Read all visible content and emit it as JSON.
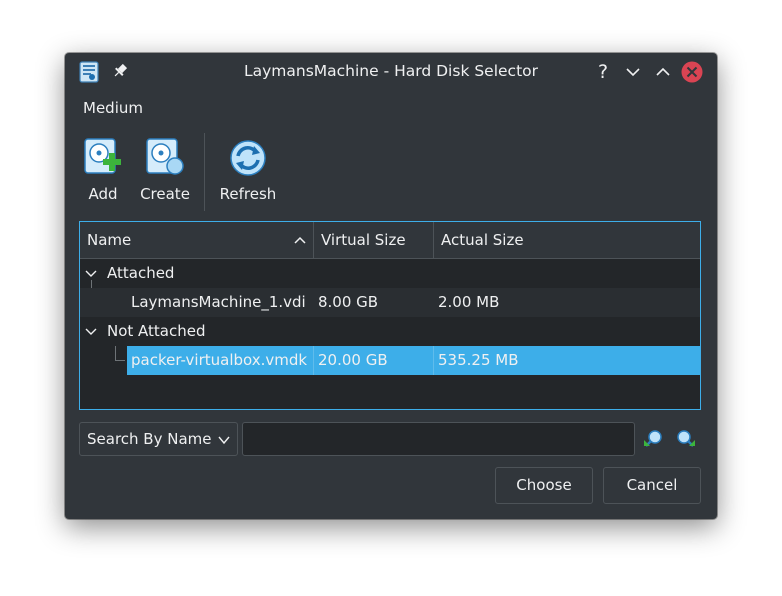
{
  "window": {
    "title": "LaymansMachine - Hard Disk Selector"
  },
  "titlebar": {
    "help": "?"
  },
  "menubar": {
    "items": [
      "Medium"
    ]
  },
  "toolbar": {
    "add": "Add",
    "create": "Create",
    "refresh": "Refresh"
  },
  "table": {
    "columns": [
      "Name",
      "Virtual Size",
      "Actual Size"
    ],
    "sort_column": "Name",
    "sort_order": "ascending",
    "groups": [
      {
        "label": "Attached",
        "items": [
          {
            "name": "LaymansMachine_1.vdi",
            "virtual_size": "8.00 GB",
            "actual_size": "2.00 MB"
          }
        ]
      },
      {
        "label": "Not Attached",
        "items": [
          {
            "name": "packer-virtualbox.vmdk",
            "virtual_size": "20.00 GB",
            "actual_size": "535.25 MB",
            "selected": true
          }
        ]
      }
    ]
  },
  "search": {
    "mode": "Search By Name",
    "value": ""
  },
  "buttons": {
    "choose": "Choose",
    "cancel": "Cancel"
  },
  "colors": {
    "background": "#31363b",
    "view": "#232629",
    "selection": "#3daee9",
    "close": "#da4453",
    "text": "#eff0f1"
  }
}
